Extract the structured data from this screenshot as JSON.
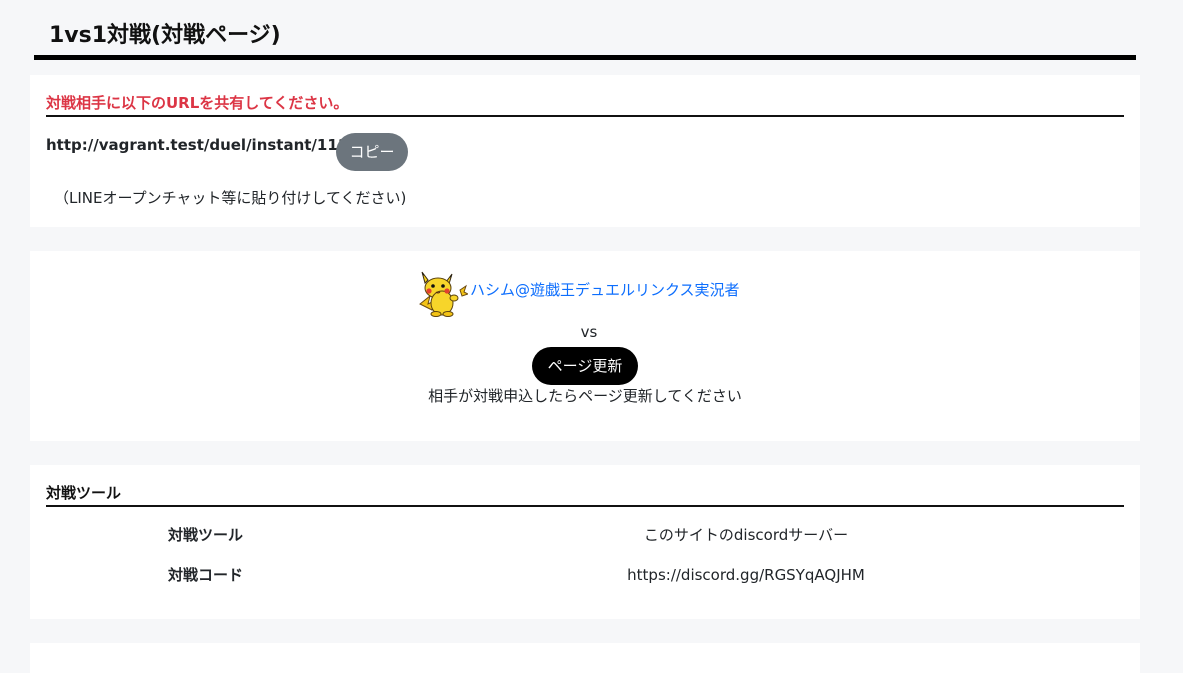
{
  "page": {
    "title": "1vs1対戦(対戦ページ)"
  },
  "share": {
    "heading": "対戦相手に以下のURLを共有してください。",
    "url": "http://vagrant.test/duel/instant/111",
    "copy_label": "コピー",
    "note": "（LINEオープンチャット等に貼り付けしてください)"
  },
  "match": {
    "player_name": "ハシム@遊戯王デュエルリンクス実況者",
    "avatar_icon": "pikachu-avatar-icon",
    "vs_label": "vs",
    "refresh_label": "ページ更新",
    "waiting_message": "相手が対戦申込したらページ更新してください"
  },
  "tools": {
    "heading": "対戦ツール",
    "rows": [
      {
        "label": "対戦ツール",
        "value": "このサイトのdiscordサーバー"
      },
      {
        "label": "対戦コード",
        "value": "https://discord.gg/RGSYqAQJHM"
      }
    ]
  },
  "colors": {
    "background": "#f6f7f9",
    "card": "#ffffff",
    "heading_red": "#dc3545",
    "link_blue": "#0d6efd",
    "copy_button": "#6c757d",
    "refresh_button": "#000000"
  }
}
